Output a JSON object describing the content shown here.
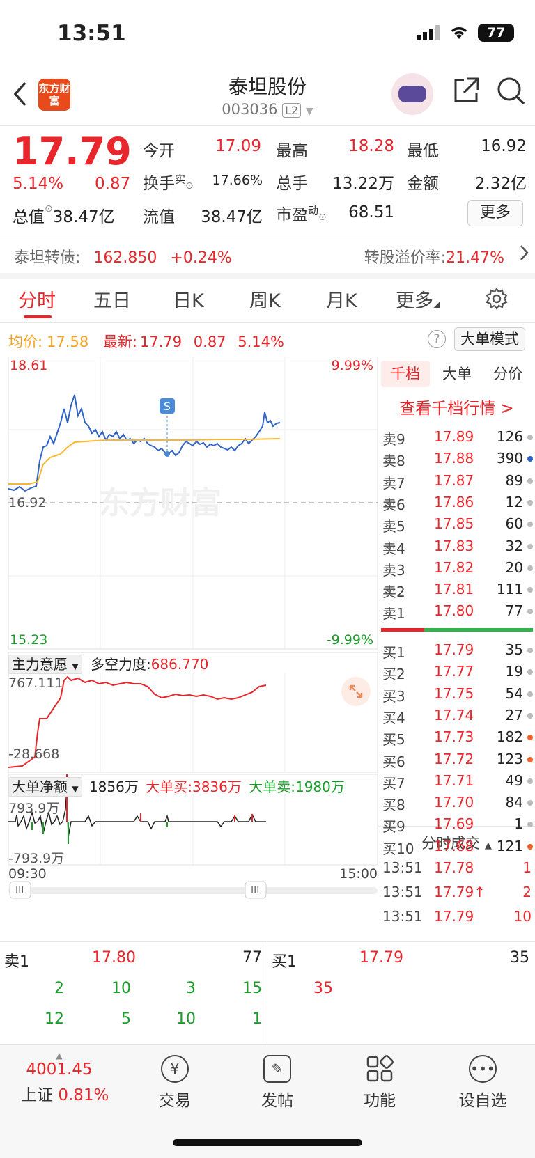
{
  "status": {
    "time": "13:51",
    "battery": "77"
  },
  "header": {
    "logo_text": "东方财富",
    "title": "泰坦股份",
    "code": "003036",
    "level": "L2"
  },
  "quote": {
    "price": "17.79",
    "pct": "5.14%",
    "change": "0.87",
    "open_label": "今开",
    "open": "17.09",
    "high_label": "最高",
    "high": "18.28",
    "low_label": "最低",
    "low": "16.92",
    "turnover_label": "换手",
    "turnover_sup": "实",
    "turnover": "17.66%",
    "volume_label": "总手",
    "volume": "13.22万",
    "amount_label": "金额",
    "amount": "2.32亿",
    "total_cap_label": "总值",
    "total_cap": "38.47亿",
    "float_cap_label": "流值",
    "float_cap": "38.47亿",
    "pe_label": "市盈",
    "pe_sup": "动",
    "pe": "68.51",
    "more": "更多"
  },
  "bond": {
    "label": "泰坦转债:",
    "price": "162.850",
    "pct": "+0.24%",
    "premium_label": "转股溢价率:",
    "premium": "21.47%"
  },
  "tabs": [
    "分时",
    "五日",
    "日K",
    "周K",
    "月K",
    "更多"
  ],
  "info": {
    "avg_label": "均价:",
    "avg": "17.58",
    "latest_label": "最新:",
    "latest": "17.79",
    "chg": "0.87",
    "pct": "5.14%",
    "mode_btn": "大单模式"
  },
  "chart": {
    "y_top": "18.61",
    "y_bottom": "15.23",
    "pct_top": "9.99%",
    "pct_bottom": "-9.99%",
    "ref": "16.92",
    "watermark": "东方财富",
    "marker": "S",
    "main_force_label": "主力意愿",
    "long_short_label": "多空力度:",
    "long_short": "686.770",
    "mf_top": "767.111",
    "mf_bottom": "-28.668",
    "net_label": "大单净额",
    "net_value": "1856万",
    "buy_label": "大单买:",
    "buy": "3836万",
    "sell_label": "大单卖:",
    "sell": "1980万",
    "net_top": "793.9万",
    "net_bottom": "-793.9万",
    "time_start": "09:30",
    "time_end": "15:00"
  },
  "orderbook": {
    "tabs": [
      "千档",
      "大单",
      "分价"
    ],
    "link": "查看千档行情 >",
    "asks": [
      {
        "label": "卖9",
        "price": "17.89",
        "vol": "126"
      },
      {
        "label": "卖8",
        "price": "17.88",
        "vol": "390"
      },
      {
        "label": "卖7",
        "price": "17.87",
        "vol": "89"
      },
      {
        "label": "卖6",
        "price": "17.86",
        "vol": "12"
      },
      {
        "label": "卖5",
        "price": "17.85",
        "vol": "60"
      },
      {
        "label": "卖4",
        "price": "17.83",
        "vol": "32"
      },
      {
        "label": "卖3",
        "price": "17.82",
        "vol": "20"
      },
      {
        "label": "卖2",
        "price": "17.81",
        "vol": "111"
      },
      {
        "label": "卖1",
        "price": "17.80",
        "vol": "77"
      }
    ],
    "bids": [
      {
        "label": "买1",
        "price": "17.79",
        "vol": "35"
      },
      {
        "label": "买2",
        "price": "17.77",
        "vol": "19"
      },
      {
        "label": "买3",
        "price": "17.75",
        "vol": "54"
      },
      {
        "label": "买4",
        "price": "17.74",
        "vol": "27"
      },
      {
        "label": "买5",
        "price": "17.73",
        "vol": "182"
      },
      {
        "label": "买6",
        "price": "17.72",
        "vol": "123"
      },
      {
        "label": "买7",
        "price": "17.71",
        "vol": "49"
      },
      {
        "label": "买8",
        "price": "17.70",
        "vol": "84"
      },
      {
        "label": "买9",
        "price": "17.69",
        "vol": "1"
      },
      {
        "label": "买10",
        "price": "17.68",
        "vol": "121"
      }
    ],
    "trades_title": "分时成交",
    "trades": [
      {
        "time": "13:51",
        "price": "17.78",
        "vol": "1"
      },
      {
        "time": "13:51",
        "price": "17.79↑",
        "vol": "2"
      },
      {
        "time": "13:51",
        "price": "17.79",
        "vol": "10"
      }
    ]
  },
  "bottom_book": {
    "ask_label": "卖1",
    "ask_price": "17.80",
    "ask_vol": "77",
    "bid_label": "买1",
    "bid_price": "17.79",
    "bid_vol": "35",
    "ask_queue_row1": [
      "2",
      "10",
      "3",
      "15"
    ],
    "ask_queue_row2": [
      "12",
      "5",
      "10",
      "1"
    ],
    "bid_queue": [
      "35"
    ]
  },
  "tabbar": {
    "index_value": "4001.45",
    "index_name": "上证",
    "index_pct": "0.81%",
    "items": [
      "交易",
      "发帖",
      "功能",
      "设自选"
    ]
  }
}
